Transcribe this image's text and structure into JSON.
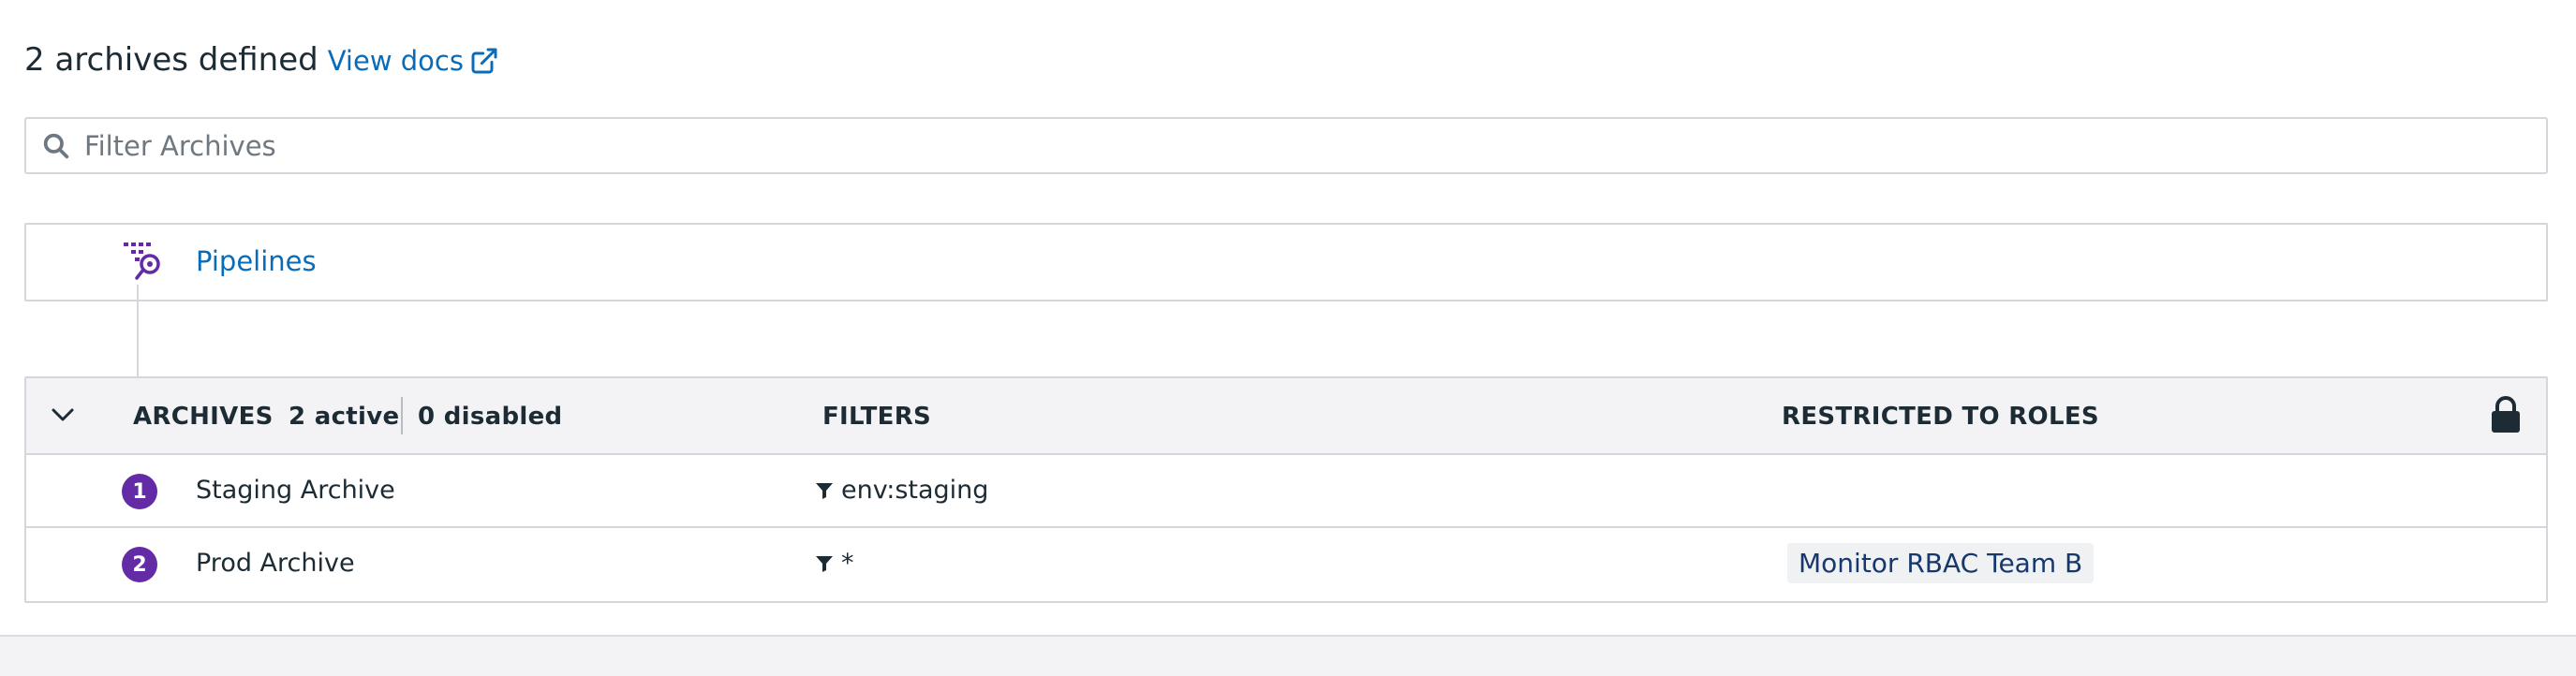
{
  "header": {
    "title": "2 archives defined",
    "docs_link": "View docs",
    "docs_icon": "external-link-icon"
  },
  "search": {
    "placeholder": "Filter Archives",
    "value": "",
    "icon": "search-icon"
  },
  "pipelines": {
    "label": "Pipelines",
    "icon": "pipelines-icon"
  },
  "table": {
    "columns": {
      "archives": "ARCHIVES",
      "active": "2 active",
      "disabled": "0 disabled",
      "filters": "FILTERS",
      "roles": "RESTRICTED TO ROLES"
    },
    "rows": [
      {
        "index": "1",
        "name": "Staging Archive",
        "filter": "env:staging",
        "role": ""
      },
      {
        "index": "2",
        "name": "Prod Archive",
        "filter": "*",
        "role": "Monitor RBAC Team B"
      }
    ]
  },
  "colors": {
    "accent_purple": "#632ca6",
    "link_blue": "#0a6cb8",
    "role_text": "#16386c",
    "header_bg": "#f3f2f5",
    "border": "#d3d6da"
  }
}
